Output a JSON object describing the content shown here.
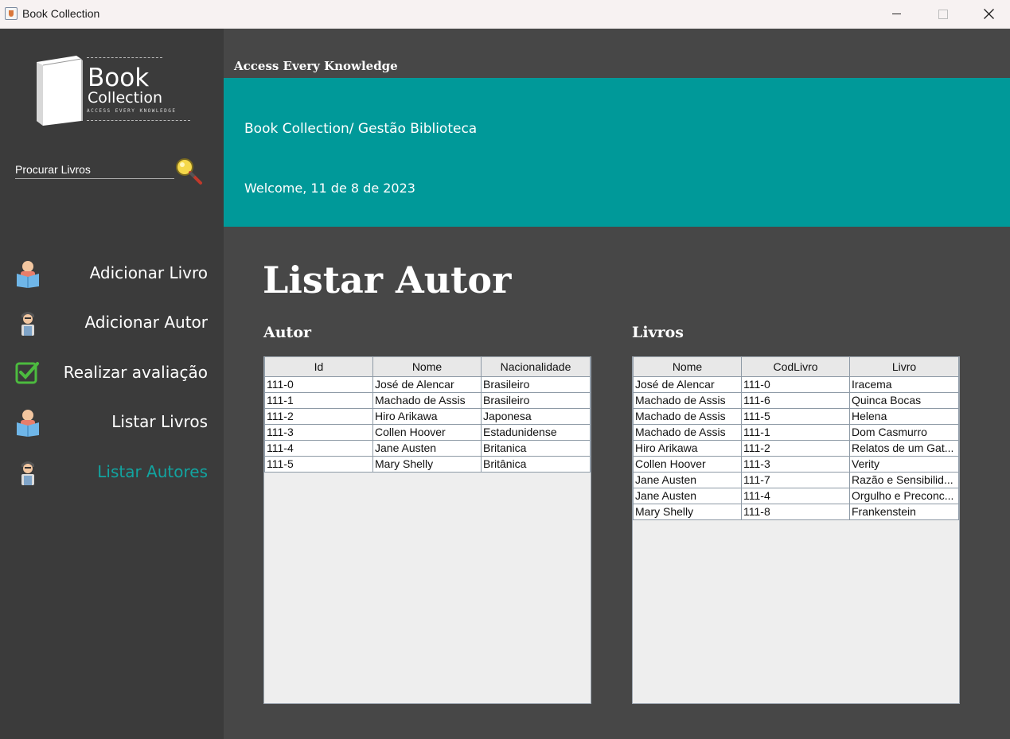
{
  "window": {
    "title": "Book Collection"
  },
  "sidebar": {
    "logo": {
      "book": "Book",
      "collection": "Collection",
      "tagline": "ACCESS EVERY KNOWLEDGE"
    },
    "search": {
      "placeholder": "Procurar Livros"
    },
    "items": [
      {
        "label": "Adicionar Livro",
        "icon": "reader-icon"
      },
      {
        "label": "Adicionar Autor",
        "icon": "author-icon"
      },
      {
        "label": "Realizar avaliação",
        "icon": "checkbox-icon"
      },
      {
        "label": "Listar Livros",
        "icon": "reader-icon"
      },
      {
        "label": "Listar Autores",
        "icon": "author-icon",
        "active": true
      }
    ]
  },
  "header": {
    "tagline": "Access Every Knowledge",
    "breadcrumb": "Book  Collection/ Gestão Biblioteca",
    "welcome": "Welcome, 11 de 8 de 2023"
  },
  "main": {
    "title": "Listar Autor",
    "authors": {
      "heading": "Autor",
      "columns": [
        "Id",
        "Nome",
        "Nacionalidade"
      ],
      "rows": [
        [
          "111-0",
          "José de Alencar",
          "Brasileiro"
        ],
        [
          "111-1",
          "Machado de Assis",
          "Brasileiro"
        ],
        [
          "111-2",
          "Hiro Arikawa",
          "Japonesa"
        ],
        [
          "111-3",
          "Collen Hoover",
          "Estadunidense"
        ],
        [
          "111-4",
          "Jane Austen",
          "Britanica"
        ],
        [
          "111-5",
          "Mary Shelly",
          "Britânica"
        ]
      ]
    },
    "books": {
      "heading": "Livros",
      "columns": [
        "Nome",
        "CodLivro",
        "Livro"
      ],
      "rows": [
        [
          "José de Alencar",
          "111-0",
          "Iracema"
        ],
        [
          "Machado de Assis",
          "111-6",
          "Quinca Bocas"
        ],
        [
          "Machado de Assis",
          "111-5",
          "Helena"
        ],
        [
          "Machado de Assis",
          "111-1",
          "Dom Casmurro"
        ],
        [
          "Hiro Arikawa",
          "111-2",
          "Relatos de um Gat..."
        ],
        [
          "Collen Hoover",
          "111-3",
          "Verity"
        ],
        [
          "Jane Austen",
          "111-7",
          "Razão e Sensibilid..."
        ],
        [
          "Jane Austen",
          "111-4",
          "Orgulho e Preconc..."
        ],
        [
          "Mary Shelly",
          "111-8",
          "Frankenstein"
        ]
      ]
    }
  },
  "colors": {
    "accent": "#009999",
    "active_nav": "#12a4a0",
    "sidebar_bg": "#3b3b3b",
    "main_bg": "#474747"
  }
}
